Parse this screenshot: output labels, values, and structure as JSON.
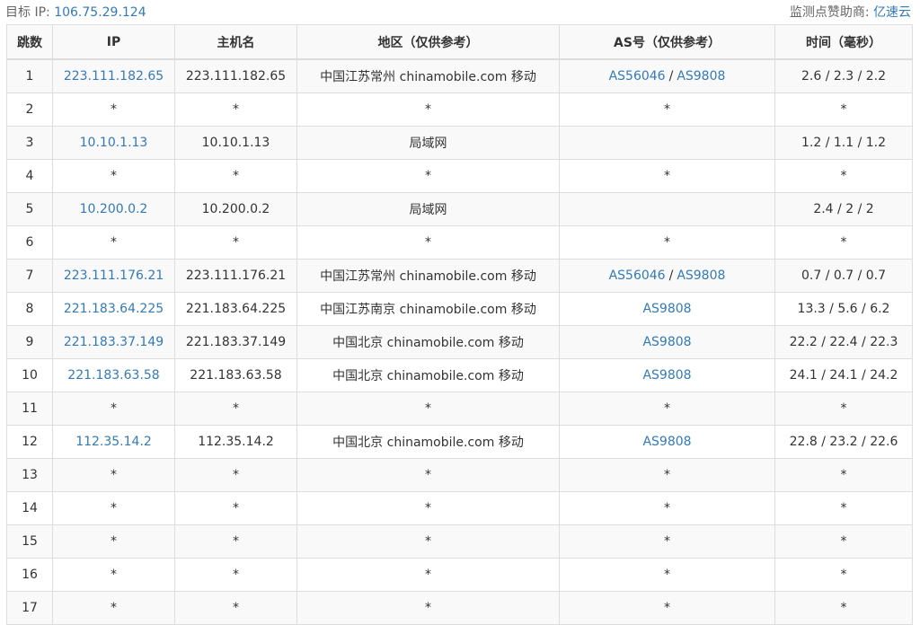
{
  "header": {
    "target_label": "目标 IP:",
    "target_ip": "106.75.29.124",
    "sponsor_label": "监测点赞助商:",
    "sponsor_name": "亿速云"
  },
  "table": {
    "columns": [
      "跳数",
      "IP",
      "主机名",
      "地区（仅供参考）",
      "AS号（仅供参考）",
      "时间（毫秒）"
    ],
    "rows": [
      {
        "hop": "1",
        "ip": "223.111.182.65",
        "host": "223.111.182.65",
        "region": "中国江苏常州 chinamobile.com 移动",
        "as": [
          "AS56046",
          "AS9808"
        ],
        "time": "2.6 / 2.3 / 2.2"
      },
      {
        "hop": "2",
        "ip": "*",
        "host": "*",
        "region": "*",
        "as": [
          "*"
        ],
        "time": "*"
      },
      {
        "hop": "3",
        "ip": "10.10.1.13",
        "host": "10.10.1.13",
        "region": "局域网",
        "as": [],
        "time": "1.2 / 1.1 / 1.2"
      },
      {
        "hop": "4",
        "ip": "*",
        "host": "*",
        "region": "*",
        "as": [
          "*"
        ],
        "time": "*"
      },
      {
        "hop": "5",
        "ip": "10.200.0.2",
        "host": "10.200.0.2",
        "region": "局域网",
        "as": [],
        "time": "2.4 / 2 / 2"
      },
      {
        "hop": "6",
        "ip": "*",
        "host": "*",
        "region": "*",
        "as": [
          "*"
        ],
        "time": "*"
      },
      {
        "hop": "7",
        "ip": "223.111.176.21",
        "host": "223.111.176.21",
        "region": "中国江苏常州 chinamobile.com 移动",
        "as": [
          "AS56046",
          "AS9808"
        ],
        "time": "0.7 / 0.7 / 0.7"
      },
      {
        "hop": "8",
        "ip": "221.183.64.225",
        "host": "221.183.64.225",
        "region": "中国江苏南京 chinamobile.com 移动",
        "as": [
          "AS9808"
        ],
        "time": "13.3 / 5.6 / 6.2"
      },
      {
        "hop": "9",
        "ip": "221.183.37.149",
        "host": "221.183.37.149",
        "region": "中国北京 chinamobile.com 移动",
        "as": [
          "AS9808"
        ],
        "time": "22.2 / 22.4 / 22.3"
      },
      {
        "hop": "10",
        "ip": "221.183.63.58",
        "host": "221.183.63.58",
        "region": "中国北京 chinamobile.com 移动",
        "as": [
          "AS9808"
        ],
        "time": "24.1 / 24.1 / 24.2"
      },
      {
        "hop": "11",
        "ip": "*",
        "host": "*",
        "region": "*",
        "as": [
          "*"
        ],
        "time": "*"
      },
      {
        "hop": "12",
        "ip": "112.35.14.2",
        "host": "112.35.14.2",
        "region": "中国北京 chinamobile.com 移动",
        "as": [
          "AS9808"
        ],
        "time": "22.8 / 23.2 / 22.6"
      },
      {
        "hop": "13",
        "ip": "*",
        "host": "*",
        "region": "*",
        "as": [
          "*"
        ],
        "time": "*"
      },
      {
        "hop": "14",
        "ip": "*",
        "host": "*",
        "region": "*",
        "as": [
          "*"
        ],
        "time": "*"
      },
      {
        "hop": "15",
        "ip": "*",
        "host": "*",
        "region": "*",
        "as": [
          "*"
        ],
        "time": "*"
      },
      {
        "hop": "16",
        "ip": "*",
        "host": "*",
        "region": "*",
        "as": [
          "*"
        ],
        "time": "*"
      },
      {
        "hop": "17",
        "ip": "*",
        "host": "*",
        "region": "*",
        "as": [
          "*"
        ],
        "time": "*"
      }
    ]
  },
  "colors": {
    "link": "#337ab7",
    "stripe": "#f9f9f9",
    "border": "#dddddd"
  }
}
